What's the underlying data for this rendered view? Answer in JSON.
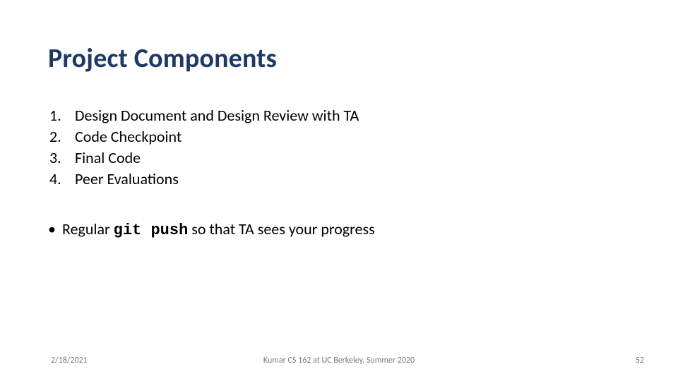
{
  "title": "Project Components",
  "items": [
    {
      "num": "1.",
      "text": "Design Document and Design Review with TA"
    },
    {
      "num": "2.",
      "text": "Code Checkpoint"
    },
    {
      "num": "3.",
      "text": "Final Code"
    },
    {
      "num": "4.",
      "text": "Peer Evaluations"
    }
  ],
  "bullet": {
    "dot": "•",
    "pre": "Regular ",
    "code": "git push",
    "post": " so that TA sees your progress"
  },
  "footer": {
    "date": "2/18/2021",
    "center": "Kumar CS 162 at UC Berkeley, Summer 2020",
    "page": "52"
  }
}
